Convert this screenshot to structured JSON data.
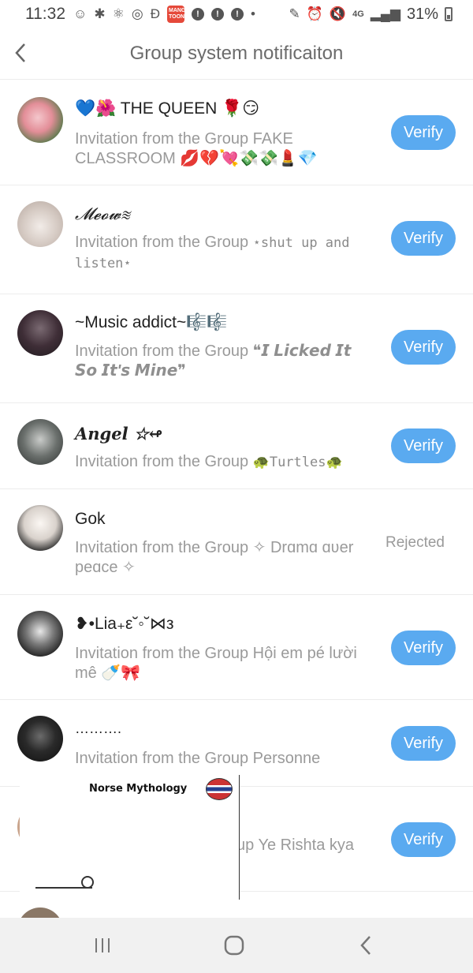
{
  "status_bar": {
    "time": "11:32",
    "network": "4G",
    "battery": "31%",
    "app_badge": "MANGA TOON"
  },
  "header": {
    "title": "Group system notificaiton"
  },
  "items": [
    {
      "name": "💙🌺 THE QUEEN 🌹😏",
      "description": "Invitation from the Group FAKE CLASSROOM 💋💔💘💸💸💄💎",
      "status": "verify",
      "action_label": "Verify",
      "avatar_color": "#e9a3a6"
    },
    {
      "name": "𝓜𝓮𝓸𝔀≋",
      "description_prefix": "Invitation from the Group ",
      "description_group": "⋆shut up and listen⋆",
      "status": "verify",
      "action_label": "Verify",
      "avatar_color": "#d9cfc9"
    },
    {
      "name": "~Music addict~🎼🎼",
      "description_prefix": "Invitation from the Group ",
      "description_group": "❝𝙄 𝙇𝙞𝙘𝙠𝙚𝙙 𝙄𝙩 𝙎𝙤 𝙄𝙩'𝙨 𝙈𝙞𝙣𝙚❞",
      "status": "verify",
      "action_label": "Verify",
      "avatar_color": "#3a2f36"
    },
    {
      "name": "𝑨𝒏𝒈𝒆𝒍 ☆↫",
      "description_prefix": "Invitation from the Group ",
      "description_group": "🐢Turtles🐢",
      "status": "verify",
      "action_label": "Verify",
      "avatar_color": "#5b5e5c"
    },
    {
      "name": "Gok",
      "description": "Invitation from the Group ✧ Drɑmɑ ɑʋer peɑce ✧",
      "status": "rejected",
      "action_label": "Rejected",
      "avatar_color": "#cfc9c4"
    },
    {
      "name": "❥•Lia₊ε˘◦˘⋈з",
      "description": "Invitation from the Group Hội em pé lười mê 🍼🎀",
      "status": "verify",
      "action_label": "Verify",
      "avatar_color": "#2b2b2b"
    },
    {
      "name": "……….",
      "description": "Invitation from the Group Personne",
      "status": "verify",
      "action_label": "Verify",
      "avatar_color": "#1e1e1e"
    },
    {
      "name": "",
      "description": "up Ye Rishta kya",
      "status": "verify",
      "action_label": "Verify",
      "avatar_color": "#c9a48c"
    }
  ],
  "overlay": {
    "title": "Norse Mythology"
  },
  "colors": {
    "accent": "#5aaaf0",
    "muted_text": "#9a9a9a",
    "nav_bg": "#f1f1f1"
  },
  "navigation": {
    "recents_icon": "recent-apps-icon",
    "home_icon": "home-icon",
    "back_icon": "back-icon"
  }
}
